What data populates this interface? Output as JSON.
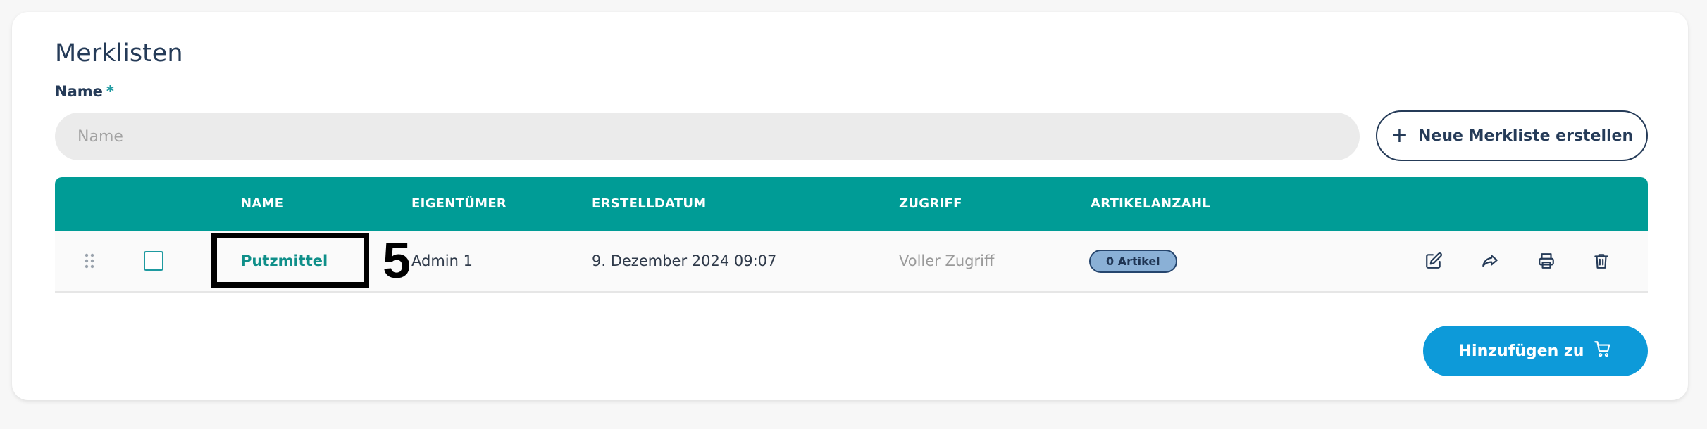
{
  "header": {
    "title": "Merklisten"
  },
  "form": {
    "name_label": "Name",
    "required_marker": "*",
    "name_placeholder": "Name",
    "create_button": "Neue Merkliste erstellen"
  },
  "table": {
    "columns": [
      "NAME",
      "EIGENTÜMER",
      "ERSTELLDATUM",
      "ZUGRIFF",
      "ARTIKELANZAHL"
    ],
    "rows": [
      {
        "name": "Putzmittel",
        "owner": "Admin 1",
        "created": "9. Dezember 2024 09:07",
        "access": "Voller Zugriff",
        "item_count": "0 Artikel",
        "selected": false
      }
    ]
  },
  "annotation": {
    "marker": "5"
  },
  "footer": {
    "add_button": "Hinzufügen zu"
  },
  "colors": {
    "primary_teal": "#009c96",
    "navy": "#253b58",
    "action_blue": "#0d9ad9"
  },
  "icons": [
    "drag-handle-icon",
    "edit-icon",
    "share-icon",
    "print-icon",
    "trash-icon",
    "cart-icon",
    "plus-icon"
  ]
}
